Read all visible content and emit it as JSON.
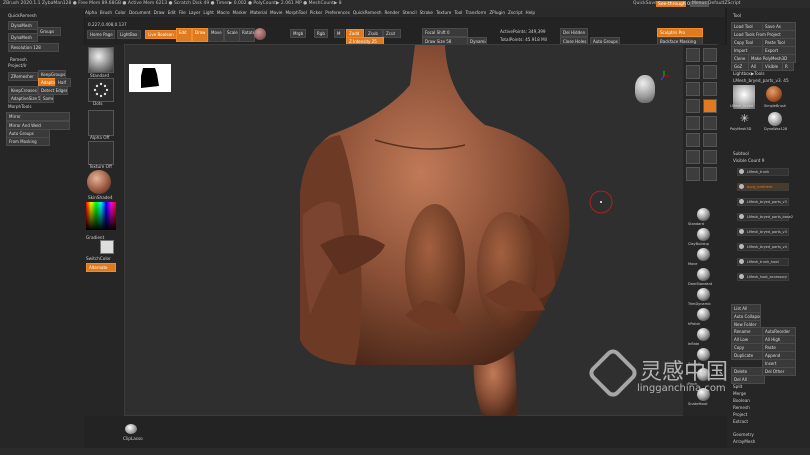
{
  "titlebar": {
    "text": "ZBrush 2020.1.1  ZybaMan128  ● Free Mem 89.68GB ● Active Mem 6213 ● Scratch Disk 49 ● Timer▶ 0.002 ● PolyCount▶ 2.061 MP ● MeshCount▶ 8",
    "quicksave": "QuickSave",
    "see_through": "See-through",
    "see_through_value": "0",
    "menus_btn": "Menus",
    "default_script": "DefaultZScript"
  },
  "menubar": {
    "items": [
      "Alpha",
      "Brush",
      "Color",
      "Document",
      "Draw",
      "Edit",
      "File",
      "Layer",
      "Light",
      "Macro",
      "Marker",
      "Material",
      "Movie",
      "MorphTool",
      "Picker",
      "Preferences",
      "QuickRemesh",
      "Render",
      "Stencil",
      "Stroke",
      "Texture",
      "Tool",
      "Transform",
      "ZPlugin",
      "Zscript",
      "Help"
    ]
  },
  "coords": "0.227,0.408,0.137",
  "left_panel": {
    "quickremesh": "QuickRemesh",
    "dynamesh": "DynaMesh",
    "groups": "Groups",
    "dynamesh2": "DynaMesh",
    "resolution": "Resolution 128",
    "remesh": "Remesh",
    "project": "Project/Ir",
    "zremesher": "ZRemesher",
    "keepgroups": "KeepGroups",
    "detect_edges": "Detect Edges",
    "keepcreases": "KeepCreases",
    "adaptive": "Adaptive",
    "half": "Half",
    "same": "Same",
    "adaptive_size": "AdaptiveSize 50",
    "morphtools": "MorphTools",
    "mirror": "Mirror",
    "mirror_weld": "Mirror And Weld",
    "auto_groups": "Auto Groups",
    "from_masking": "From Masking"
  },
  "shelf": {
    "home": "Home Page",
    "lightbox": "LightBox",
    "live_boolean": "Live Boolean",
    "edit": "Edit",
    "draw": "Draw",
    "move": "Move",
    "scale": "Scale",
    "rotate": "Rotate",
    "mrgb": "Mrgb",
    "rgb": "Rgb",
    "m": "M",
    "zadd": "Zadd",
    "zsub": "Zsub",
    "zcut": "Zcut",
    "rgb_intensity": "Rgb Intensity",
    "z_intensity": "Z Intensity 25",
    "focal_shift": "Focal Shift 0",
    "draw_size": "Draw Size 58",
    "dynamic": "Dynamic",
    "active_points": "ActivePoints: 349,399",
    "total_points": "TotalPoints: 45.918 Mil",
    "del_hidden": "Del Hidden",
    "close_holes": "Close Holes",
    "auto_groups": "Auto Groups"
  },
  "sidebar_left": {
    "standard": "Standard",
    "dots": "Dots",
    "alpha_off": "Alpha Off",
    "texture_off": "Texture Off",
    "matcap": "SkinShade4",
    "gradient": "Gradient",
    "switch_color": "SwitchColor",
    "alternate": "Alternate"
  },
  "right_tools": {
    "header": "Tool",
    "load_tool": "Load Tool",
    "save_as": "Save As",
    "load_from_project": "Load Tools From Project",
    "copy_tool": "Copy Tool",
    "paste_tool": "Paste Tool",
    "import": "Import",
    "export": "Export",
    "clone": "Clone",
    "make_polymesh": "Make PolyMesh3D",
    "goz": "GoZ",
    "all": "All",
    "visible": "Visible",
    "r": "R",
    "lightbox_tools": "Lightbox▶Tools",
    "current_tool": "LMesh_bryed_parts_v3. 45",
    "subtools": [
      "LMesh_bryed",
      "SimpleBrush",
      "PolyMesh3D",
      "DynaWax128"
    ],
    "subtool_header": "Subtool",
    "visible_count": "Visible Count 9",
    "subtool_items": [
      "LMesh_trunk",
      "body_brethere",
      "LMesh_bryed_parts_v3",
      "LMesh_bryed_parts_base2",
      "LMesh_bryed_parts_v3",
      "LMesh_bryed_parts_v4",
      "LMesh_trunk_hoot",
      "LMesh_hoot_accessory"
    ],
    "list_all": "List All",
    "auto_collapse": "Auto Collapse",
    "new_folder": "New Folder",
    "rename": "Rename",
    "autoreorder": "AutoReorder",
    "all_low": "All Low",
    "all_high": "All High",
    "copy": "Copy",
    "paste": "Paste",
    "duplicate": "Duplicate",
    "append": "Append",
    "insert": "Insert",
    "delete": "Delete",
    "del_other": "Del Other",
    "del_all": "Del All",
    "split": "Split",
    "merge": "Merge",
    "boolean": "Boolean",
    "remesh": "Remesh",
    "project": "Project",
    "extract": "Extract",
    "geometry": "Geometry",
    "arraymesh": "ArrayMesh"
  },
  "right_strip": {
    "sculptris": "Sculptris Pro",
    "backface": "Backface Masking",
    "brushes": [
      "Standard",
      "ClayBuildup",
      "Move",
      "DamStandard",
      "TrimDynamic",
      "hPolish",
      "Inflate",
      "Smooth",
      "Pinch",
      "SnakeHook"
    ]
  },
  "bottom": {
    "cliplasso": "ClipLasso"
  },
  "watermark": {
    "brand": "灵感中国",
    "url": "lingganchina.com"
  },
  "colors": {
    "accent": "#e07a1f",
    "skin": "#8a4f36",
    "viewport": "#2f2f2f"
  }
}
